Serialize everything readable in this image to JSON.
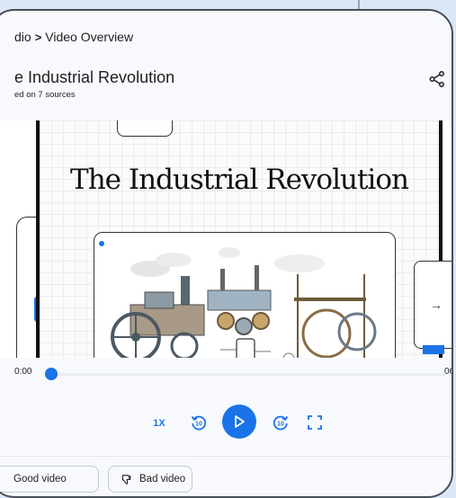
{
  "breadcrumb": {
    "parent": "dio",
    "current": "Video Overview"
  },
  "overview": {
    "title": "e Industrial Revolution",
    "subtitle": "ed on 7 sources"
  },
  "slide": {
    "title": "The Industrial Revolution"
  },
  "player": {
    "time_current": "0:00",
    "time_total": "06",
    "progress": 0.0,
    "speed_label": "1X",
    "rewind_seconds": "10",
    "forward_seconds": "10"
  },
  "feedback": {
    "good_label": "Good video",
    "bad_label": "Bad video"
  },
  "icons": {
    "share": "share-icon",
    "rewind": "rewind-10-icon",
    "play": "play-icon",
    "forward": "forward-10-icon",
    "fullscreen": "fullscreen-icon",
    "thumbs_up": "thumbs-up-icon",
    "thumbs_down": "thumbs-down-icon",
    "next": "arrow-right-icon"
  },
  "colors": {
    "accent": "#1a73e8",
    "background": "#dbe6f7",
    "panel": "#f7f9fd"
  }
}
